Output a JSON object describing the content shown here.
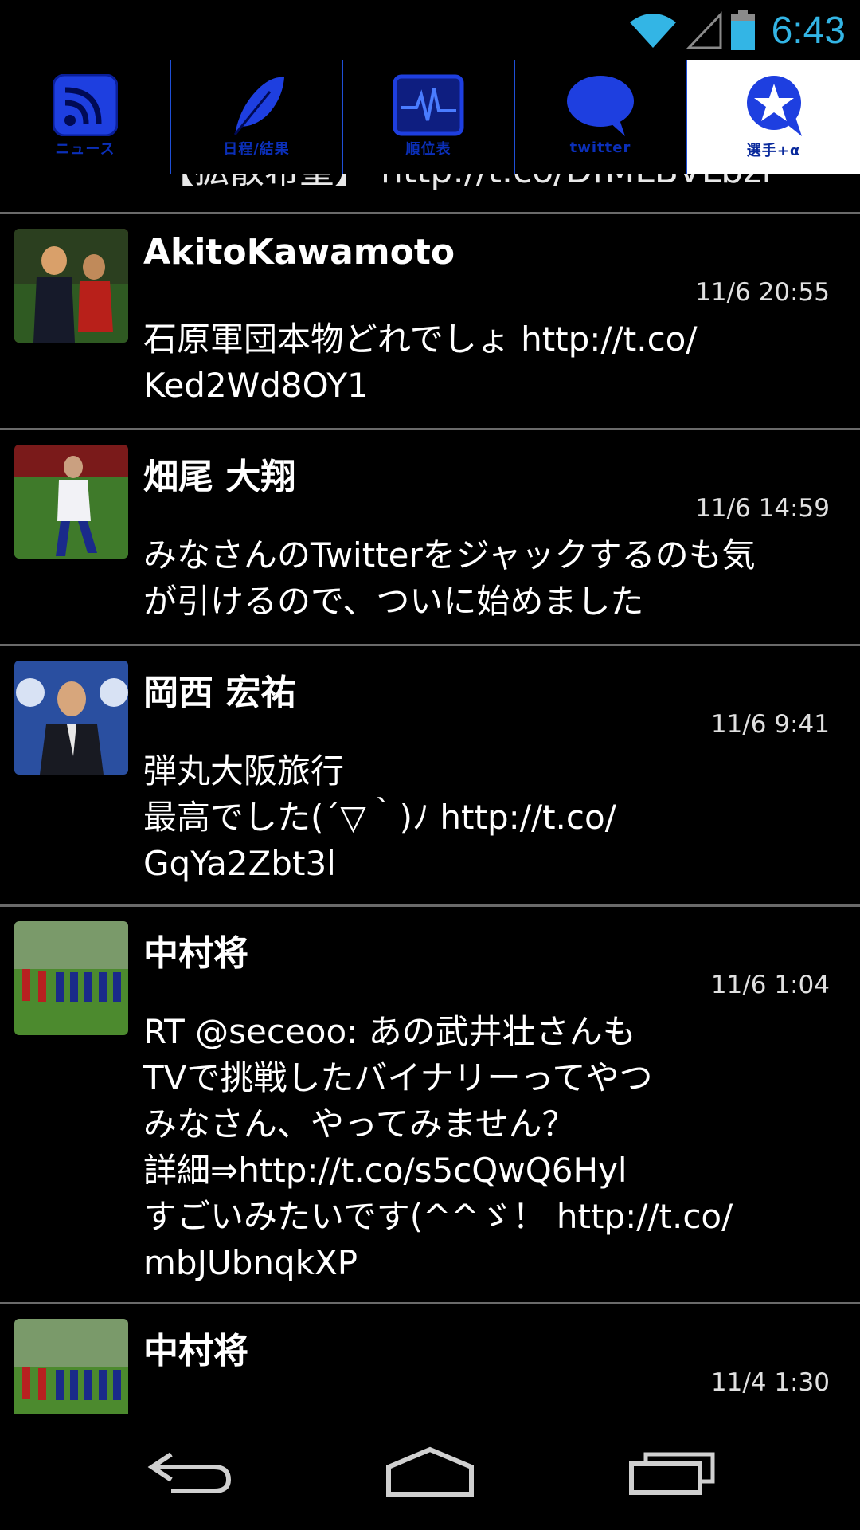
{
  "status_bar": {
    "time": "6:43",
    "icons": [
      "wifi-icon",
      "signal-icon",
      "battery-icon"
    ],
    "accent": "#33b5e5"
  },
  "tabs": [
    {
      "label": "ニュース",
      "icon": "rss-icon"
    },
    {
      "label": "日程/結果",
      "icon": "feather-icon"
    },
    {
      "label": "順位表",
      "icon": "chart-monitor-icon"
    },
    {
      "label": "twitter",
      "icon": "speech-bubble-icon"
    },
    {
      "label": "選手+α",
      "icon": "star-bubble-icon",
      "active": true
    }
  ],
  "feed": {
    "cut_off_text": "【拡散希望】 http://t.co/DfMLBVLbzI",
    "items": [
      {
        "user": "AkitoKawamoto",
        "time": "11/6 20:55",
        "text": "石原軍団本物どれでしょ http://t.co/\nKed2Wd8OY1"
      },
      {
        "user": "畑尾 大翔",
        "time": "11/6 14:59",
        "text": "みなさんのTwitterをジャックするのも気\nが引けるので、ついに始めました"
      },
      {
        "user": "岡西 宏祐",
        "time": "11/6 9:41",
        "text": "弾丸大阪旅行\n最高でした(´▽｀)ﾉ http://t.co/\nGqYa2Zbt3l"
      },
      {
        "user": "中村将",
        "time": "11/6 1:04",
        "text": "RT @seceoo: あの武井壮さんも\nTVで挑戦したバイナリーってやつ\nみなさん、やってみません？\n詳細⇒http://t.co/s5cQwQ6Hyl\nすごいみたいです(^^ゞ！ http://t.co/\nmbJUbnqkXP"
      },
      {
        "user": "中村将",
        "time": "11/4 1:30",
        "text": ""
      }
    ]
  },
  "nav_bar": {
    "buttons": [
      "back-icon",
      "home-icon",
      "recent-apps-icon"
    ]
  }
}
